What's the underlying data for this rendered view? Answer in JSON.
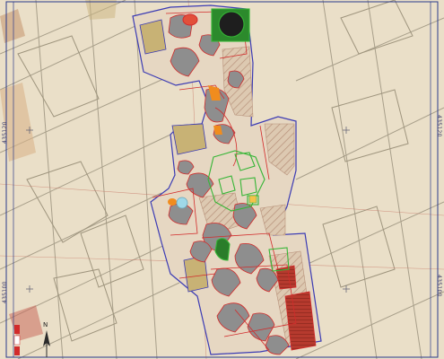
{
  "map": {
    "frame_labels": {
      "left_upper": "435120",
      "right_upper": "435120",
      "left_lower": "435100",
      "right_lower": "435100"
    },
    "north_label": "N",
    "colors": {
      "background": "#ece3cf",
      "cadastral_lines": "#a89f8a",
      "excavation_outline": "#3b3bb4",
      "feature_fill": "#8e8e8e",
      "red_features": "#d22b2b",
      "green_features": "#35b535",
      "hatched_zone": "#c9a98b",
      "tan_fill": "#c8b275",
      "orange_feature": "#f08c1e",
      "frame_border": "#2b3b8c",
      "cyan_marker": "#9fd8e8"
    }
  }
}
